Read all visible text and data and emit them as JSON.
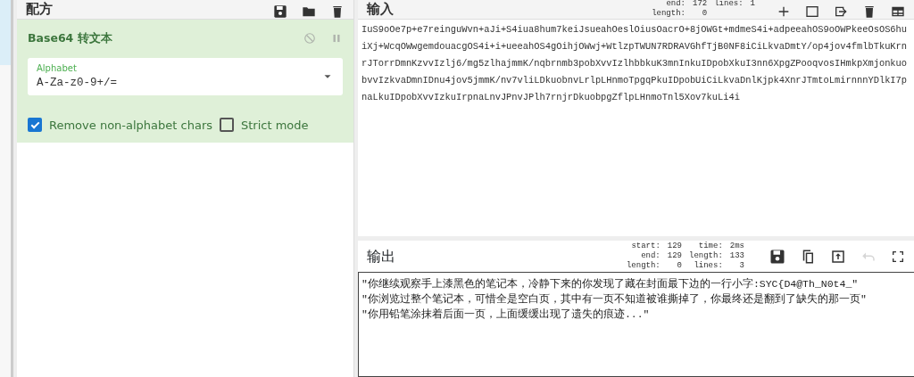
{
  "recipe": {
    "title": "配方",
    "operation": {
      "title": "Base64 转文本",
      "disabled": false,
      "paused": false,
      "alphabet": {
        "label": "Alphabet",
        "value": "A-Za-z0-9+/="
      },
      "options": [
        {
          "label": "Remove non-alphabet chars",
          "checked": true
        },
        {
          "label": "Strict mode",
          "checked": false
        }
      ]
    }
  },
  "input": {
    "title": "输入",
    "stats": [
      {
        "label": "end:",
        "value": "172"
      },
      {
        "label": "length:",
        "value": "0"
      },
      {
        "label": "lines:",
        "value": "1"
      }
    ],
    "text": "IuS9oOe7p+e7reinguWvn+aJi+S4iua8hum7keiJsueahOeslOiusOacrO+8jOWGt+mdmeS4i+adpeeahOS9oOWPkeeOsOS6huiXj+WcqOWwgemdouacgOS4i+i+ueeahOS4gOihjOWwj+WtlzpTWUN7RDRAVGhfTjB0NF8iCiLkvaDmtY/op4jov4fmlbTkuKrnrJTorrDmnKzvvIzlj6/mg5zlhajmmK/nqbrnmb3pobXvvIzlhbbkuK3mnInkuIDpobXkuI3nn6XpgZPooqvosIHmkpXmjonkuobvvIzkvaDmnIDnu4jov5jmmK/nv7vliLDkuobnvLrlpLHnmoTpgqPkuIDpobUiCiLkvaDnlKjpk4XnrJTmtoLmirnnnYDlkI7pnaLkuIDpobXvvIzkuIrpnaLnvJPnvJPlh7rnjrDkuobpgZflpLHnmoTnl5Xov7kuLi4i"
  },
  "output": {
    "title": "输出",
    "stats": [
      {
        "label": "start:",
        "value": "129"
      },
      {
        "label": "end:",
        "value": "129"
      },
      {
        "label": "length:",
        "value": "0"
      },
      {
        "label": "time:",
        "value": "2ms"
      },
      {
        "label": "length:",
        "value": "133"
      },
      {
        "label": "lines:",
        "value": "3"
      }
    ],
    "undo_disabled": true,
    "lines": [
      "\"你继续观察手上漆黑色的笔记本，冷静下来的你发现了藏在封面最下边的一行小字:SYC{D4@Th_N0t4_\"",
      "\"你浏览过整个笔记本，可惜全是空白页，其中有一页不知道被谁撕掉了，你最终还是翻到了缺失的那一页\"",
      "\"你用铅笔涂抹着后面一页，上面缓缓出现了遗失的痕迹...\""
    ]
  }
}
